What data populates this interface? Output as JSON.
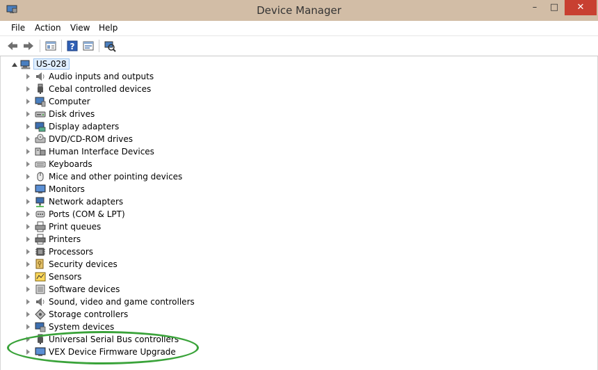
{
  "window": {
    "title": "Device Manager",
    "minimize_label": "–",
    "maximize_label": "□",
    "close_label": "✕"
  },
  "menu": {
    "items": [
      {
        "label": "File"
      },
      {
        "label": "Action"
      },
      {
        "label": "View"
      },
      {
        "label": "Help"
      }
    ]
  },
  "toolbar": {
    "buttons": [
      {
        "icon": "back-arrow-icon"
      },
      {
        "icon": "forward-arrow-icon"
      },
      {
        "icon": "properties-icon"
      },
      {
        "icon": "help-icon"
      },
      {
        "icon": "update-driver-icon"
      },
      {
        "icon": "scan-hardware-icon"
      }
    ]
  },
  "tree": {
    "root": {
      "label": "US-028",
      "icon": "computer-icon"
    },
    "categories": [
      {
        "label": "Audio inputs and outputs",
        "icon": "speaker-icon"
      },
      {
        "label": "Cebal controlled devices",
        "icon": "usb-plug-icon"
      },
      {
        "label": "Computer",
        "icon": "computer-icon"
      },
      {
        "label": "Disk drives",
        "icon": "disk-drive-icon"
      },
      {
        "label": "Display adapters",
        "icon": "display-adapter-icon"
      },
      {
        "label": "DVD/CD-ROM drives",
        "icon": "dvd-drive-icon"
      },
      {
        "label": "Human Interface Devices",
        "icon": "hid-icon"
      },
      {
        "label": "Keyboards",
        "icon": "keyboard-icon"
      },
      {
        "label": "Mice and other pointing devices",
        "icon": "mouse-icon"
      },
      {
        "label": "Monitors",
        "icon": "monitor-icon"
      },
      {
        "label": "Network adapters",
        "icon": "network-adapter-icon"
      },
      {
        "label": "Ports (COM & LPT)",
        "icon": "port-icon"
      },
      {
        "label": "Print queues",
        "icon": "print-queue-icon"
      },
      {
        "label": "Printers",
        "icon": "printer-icon"
      },
      {
        "label": "Processors",
        "icon": "processor-icon"
      },
      {
        "label": "Security devices",
        "icon": "security-key-icon"
      },
      {
        "label": "Sensors",
        "icon": "sensor-icon"
      },
      {
        "label": "Software devices",
        "icon": "software-device-icon"
      },
      {
        "label": "Sound, video and game controllers",
        "icon": "speaker-icon"
      },
      {
        "label": "Storage controllers",
        "icon": "storage-controller-icon"
      },
      {
        "label": "System devices",
        "icon": "system-device-icon"
      },
      {
        "label": "Universal Serial Bus controllers",
        "icon": "usb-plug-icon"
      },
      {
        "label": "VEX Device Firmware Upgrade",
        "icon": "monitor-icon"
      }
    ]
  },
  "colors": {
    "titlebar": "#d2bda6",
    "close_button": "#c84031",
    "highlight_ring": "#3aa33a",
    "selection": "#e1efff"
  }
}
